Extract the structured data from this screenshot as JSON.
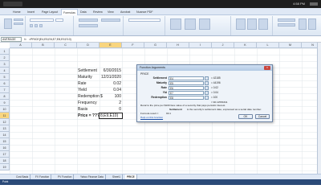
{
  "window": {
    "title": "Function Arguments",
    "clock": "4:58 PM"
  },
  "ribbon_tabs": [
    "Home",
    "Insert",
    "Page Layout",
    "Formulas",
    "Data",
    "Review",
    "View",
    "Acrobat",
    "Nuance PDF"
  ],
  "formula_bar": {
    "name_box": "AVERAGE",
    "fx": "fx",
    "formula": "=PRICE(E4,E5,E6,E7,E8,E9,E10)"
  },
  "columns": [
    "A",
    "B",
    "C",
    "D",
    "E",
    "F",
    "G",
    "H",
    "I",
    "J",
    "K",
    "L",
    "M",
    "N"
  ],
  "rows": [
    "1",
    "2",
    "3",
    "4",
    "5",
    "6",
    "7",
    "8",
    "9",
    "10",
    "11",
    "12",
    "13",
    "14",
    "15",
    "16",
    "17",
    "18",
    "19"
  ],
  "active": {
    "column": "E",
    "row": "11"
  },
  "cells": [
    {
      "label": "Settlement",
      "value": "6/30/2015"
    },
    {
      "label": "Maturity",
      "value": "12/31/2020"
    },
    {
      "label": "Rate",
      "value": "0.02"
    },
    {
      "label": "Yield",
      "value": "0.04"
    },
    {
      "label": "Redemption",
      "currency": "$",
      "value": "100"
    },
    {
      "label": "Frequency",
      "value": "2"
    },
    {
      "label": "Basis",
      "value": "0"
    }
  ],
  "price_row": {
    "label": "Price = ???",
    "value": "8,E9,E10)"
  },
  "dialog": {
    "title": "Function Arguments",
    "function": "PRICE",
    "args": [
      {
        "label": "Settlement",
        "input": "E4",
        "result": "= 42185"
      },
      {
        "label": "Maturity",
        "input": "E5",
        "result": "= 44196"
      },
      {
        "label": "Rate",
        "input": "E6",
        "result": "= 0.02"
      },
      {
        "label": "Yld",
        "input": "E7",
        "result": "= 0.04"
      },
      {
        "label": "Redemption",
        "input": "E8",
        "result": "= 100"
      }
    ],
    "total": "= 90.11553341",
    "description": "Returns the price per $100 face value of a security that pays periodic interest.",
    "arg_help_name": "Settlement",
    "arg_help": "is the security's settlement date, expressed as a serial date number.",
    "formula_result_label": "Formula result =",
    "formula_result": "90.1",
    "help_link": "Help on this function",
    "ok": "OK",
    "cancel": "Cancel"
  },
  "sheet_tabs": [
    "Cost Basis",
    "FV Function",
    "PV Function",
    "Yahoo Finance Data",
    "Sheet1",
    "PRICE"
  ],
  "active_sheet": "PRICE",
  "status": "Point"
}
